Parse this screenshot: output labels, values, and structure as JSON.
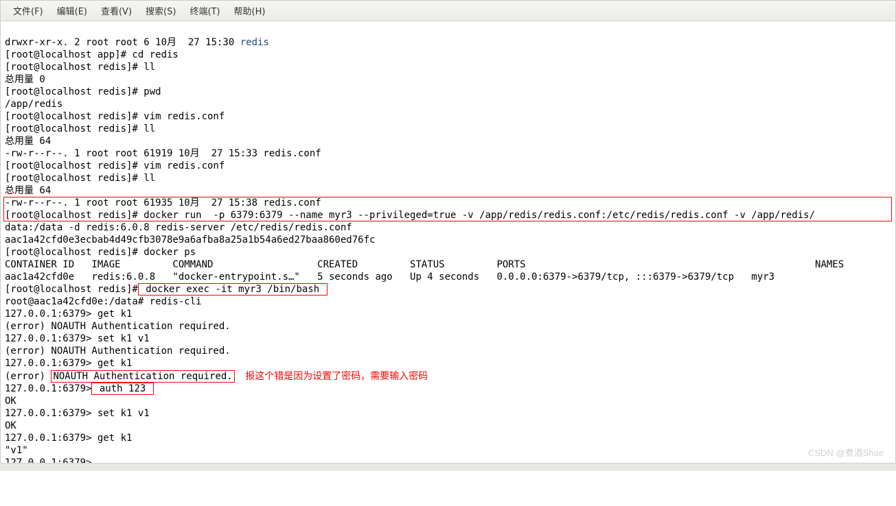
{
  "menubar": {
    "file": "文件(F)",
    "edit": "编辑(E)",
    "view": "查看(V)",
    "search": "搜索(S)",
    "terminal": "终端(T)",
    "help": "帮助(H)"
  },
  "lines": {
    "l01a": "drwxr-xr-x. 2 root root 6 10月  27 15:30 ",
    "l01b": "redis",
    "l02": "[root@localhost app]# cd redis",
    "l03": "[root@localhost redis]# ll",
    "l04": "总用量 0",
    "l05": "[root@localhost redis]# pwd",
    "l06": "/app/redis",
    "l07": "[root@localhost redis]# vim redis.conf",
    "l08": "[root@localhost redis]# ll",
    "l09": "总用量 64",
    "l10": "-rw-r--r--. 1 root root 61919 10月  27 15:33 redis.conf",
    "l11": "[root@localhost redis]# vim redis.conf",
    "l12": "[root@localhost redis]# ll",
    "l13": "总用量 64",
    "l14": "-rw-r--r--. 1 root root 61935 10月  27 15:38 redis.conf",
    "l15": "[root@localhost redis]# docker run  -p 6379:6379 --name myr3 --privileged=true -v /app/redis/redis.conf:/etc/redis/redis.conf -v /app/redis/",
    "l16": "data:/data -d redis:6.0.8 redis-server /etc/redis/redis.conf",
    "l17": "aac1a42cfd0e3ecbab4d49cfb3078e9a6afba8a25a1b54a6ed27baa860ed76fc",
    "l18": "[root@localhost redis]# docker ps",
    "l19": "CONTAINER ID   IMAGE         COMMAND                  CREATED         STATUS         PORTS                                                  NAMES",
    "l20": "aac1a42cfd0e   redis:6.0.8   \"docker-entrypoint.s…\"   5 seconds ago   Up 4 seconds   0.0.0.0:6379->6379/tcp, :::6379->6379/tcp   myr3",
    "l21a": "[root@localhost redis]#",
    "l21b": " docker exec -it myr3 /bin/bash ",
    "l22": "root@aac1a42cfd0e:/data# redis-cli",
    "l23": "127.0.0.1:6379> get k1",
    "l24": "(error) NOAUTH Authentication required.",
    "l25": "127.0.0.1:6379> set k1 v1",
    "l26": "(error) NOAUTH Authentication required.",
    "l27": "127.0.0.1:6379> get k1",
    "l28a": "(error) ",
    "l28b": "NOAUTH Authentication required.",
    "annotation": "    报这个错是因为设置了密码，需要输入密码",
    "l29a": "127.0.0.1:6379>",
    "l29b": " auth 123 ",
    "l30": "OK",
    "l31": "127.0.0.1:6379> set k1 v1",
    "l32": "OK",
    "l33": "127.0.0.1:6379> get k1",
    "l34": "\"v1\"",
    "l35": "127.0.0.1:6379> "
  },
  "watermark": "CSDN @煮酒Shae"
}
